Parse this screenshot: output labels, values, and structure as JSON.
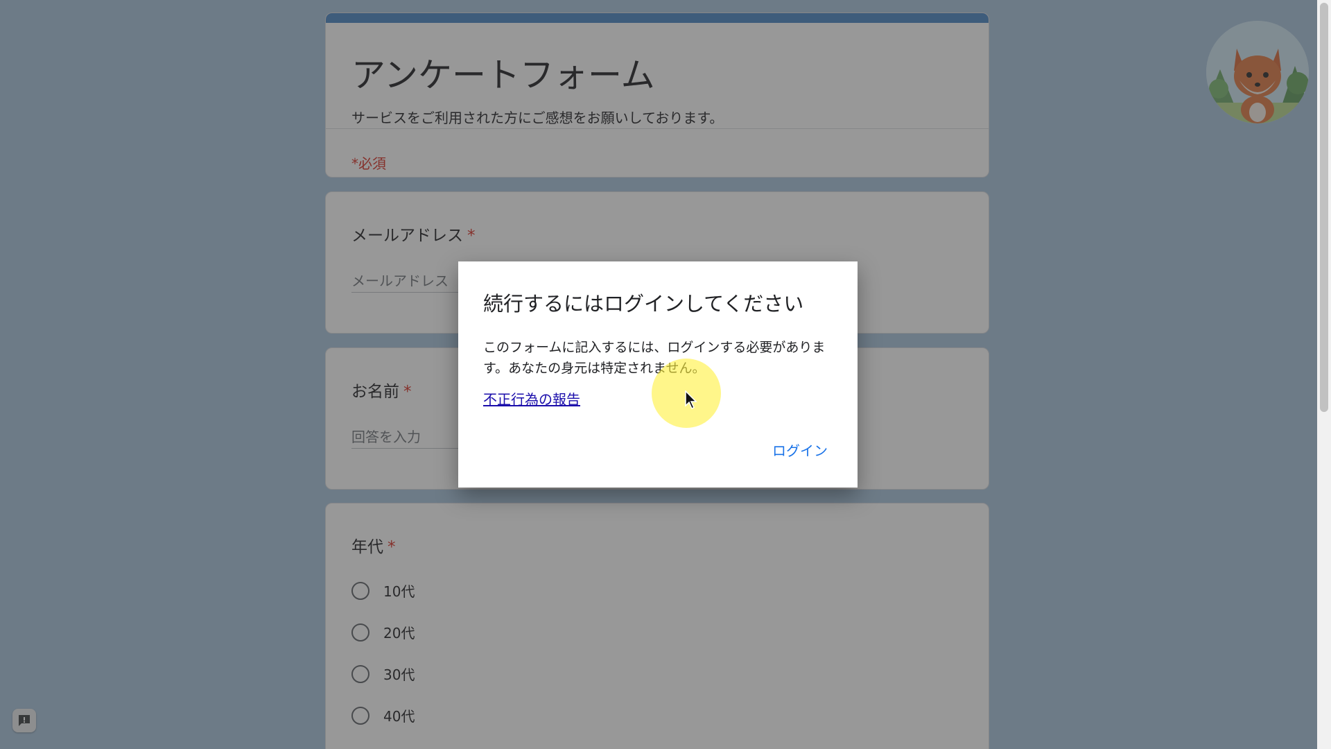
{
  "colors": {
    "accent": "#4a86c5",
    "required": "#d93025",
    "link": "#1a0dab",
    "button_text": "#1a73e8",
    "page_background": "#a9c4dc",
    "cursor_highlight": "#fff03c"
  },
  "form": {
    "title": "アンケートフォーム",
    "description": "サービスをご利用された方にご感想をお願いしております。",
    "required_note": "*必須"
  },
  "questions": {
    "email": {
      "label": "メールアドレス",
      "required_mark": "*",
      "placeholder": "メールアドレス"
    },
    "name": {
      "label": "お名前",
      "required_mark": "*",
      "placeholder": "回答を入力"
    },
    "age": {
      "label": "年代",
      "required_mark": "*",
      "options": [
        "10代",
        "20代",
        "30代",
        "40代"
      ]
    }
  },
  "dialog": {
    "title": "続行するにはログインしてください",
    "body": "このフォームに記入するには、ログインする必要があります。あなたの身元は特定されません。",
    "report_link": "不正行為の報告",
    "login_button": "ログイン"
  },
  "icons": {
    "avatar": "fox-avatar-icon",
    "feedback": "report-feedback-icon",
    "cursor": "mouse-pointer-icon"
  }
}
